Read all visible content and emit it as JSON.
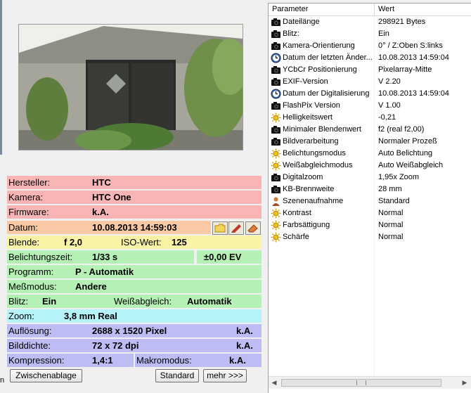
{
  "left_edge": {
    "label": "n"
  },
  "metadata": {
    "hersteller": {
      "label": "Hersteller:",
      "value": "HTC"
    },
    "kamera": {
      "label": "Kamera:",
      "value": "HTC One"
    },
    "firmware": {
      "label": "Firmware:",
      "value": "k.A."
    },
    "datum": {
      "label": "Datum:",
      "value": "10.08.2013 14:59:03"
    },
    "blende": {
      "label": "Blende:",
      "value": "f 2,0"
    },
    "iso": {
      "label": "ISO-Wert:",
      "value": "125"
    },
    "belichtungszeit": {
      "label": "Belichtungszeit:",
      "value": "1/33 s"
    },
    "ev": {
      "value": "±0,00 EV"
    },
    "programm": {
      "label": "Programm:",
      "value": "P - Automatik"
    },
    "messmodus": {
      "label": "Meßmodus:",
      "value": "Andere"
    },
    "blitz": {
      "label": "Blitz:",
      "value": "Ein"
    },
    "weissabgleich": {
      "label": "Weißabgleich:",
      "value": "Automatik"
    },
    "zoom": {
      "label": "Zoom:",
      "value": "3,8 mm Real"
    },
    "aufloesung": {
      "label": "Auflösung:",
      "value": "2688 x 1520 Pixel",
      "extra": "k.A."
    },
    "bilddichte": {
      "label": "Bilddichte:",
      "value": "72 x 72 dpi",
      "extra": "k.A."
    },
    "kompression": {
      "label": "Kompression:",
      "value": "1,4:1"
    },
    "makromodus": {
      "label": "Makromodus:",
      "value": "k.A."
    }
  },
  "buttons": {
    "zwischenablage": "Zwischenablage",
    "standard": "Standard",
    "mehr": "mehr >>>"
  },
  "table": {
    "headers": [
      "Parameter",
      "Wert"
    ],
    "rows": [
      {
        "icon": "camera",
        "name": "Dateilänge",
        "value": "298921 Bytes"
      },
      {
        "icon": "camera",
        "name": "Blitz:",
        "value": "Ein"
      },
      {
        "icon": "camera",
        "name": "Kamera-Orientierung",
        "value": "0° / Z:Oben S:links"
      },
      {
        "icon": "clock",
        "name": "Datum der letzten Änder...",
        "value": "10.08.2013 14:59:04"
      },
      {
        "icon": "camera",
        "name": "YCbCr Positionierung",
        "value": "Pixelarray-Mitte"
      },
      {
        "icon": "camera",
        "name": "EXIF-Version",
        "value": "V 2.20"
      },
      {
        "icon": "clock",
        "name": "Datum der Digitalisierung",
        "value": "10.08.2013 14:59:04"
      },
      {
        "icon": "camera",
        "name": "FlashPix Version",
        "value": "V 1.00"
      },
      {
        "icon": "sun",
        "name": "Helligkeitswert",
        "value": "-0,21"
      },
      {
        "icon": "camera",
        "name": "Minimaler Blendenwert",
        "value": "f2 (real f2,00)"
      },
      {
        "icon": "camera",
        "name": "Bildverarbeitung",
        "value": "Normaler Prozeß"
      },
      {
        "icon": "sun",
        "name": "Belichtungsmodus",
        "value": "Auto Belichtung"
      },
      {
        "icon": "sun",
        "name": "Weißabgleichmodus",
        "value": "Auto Weißabgleich"
      },
      {
        "icon": "camera",
        "name": "Digitalzoom",
        "value": "1,95x Zoom"
      },
      {
        "icon": "camera",
        "name": "KB-Brennweite",
        "value": "28 mm"
      },
      {
        "icon": "person",
        "name": "Szenenaufnahme",
        "value": "Standard"
      },
      {
        "icon": "sun",
        "name": "Kontrast",
        "value": "Normal"
      },
      {
        "icon": "sun",
        "name": "Farbsättigung",
        "value": "Normal"
      },
      {
        "icon": "sun",
        "name": "Schärfe",
        "value": "Normal"
      }
    ]
  },
  "colors": {
    "red": "#f8b5b5",
    "orange": "#f9c9a5",
    "yellow": "#f9f3a5",
    "green": "#b5f0b5",
    "cyan": "#b5f3f8",
    "blue": "#bdbdf3"
  }
}
